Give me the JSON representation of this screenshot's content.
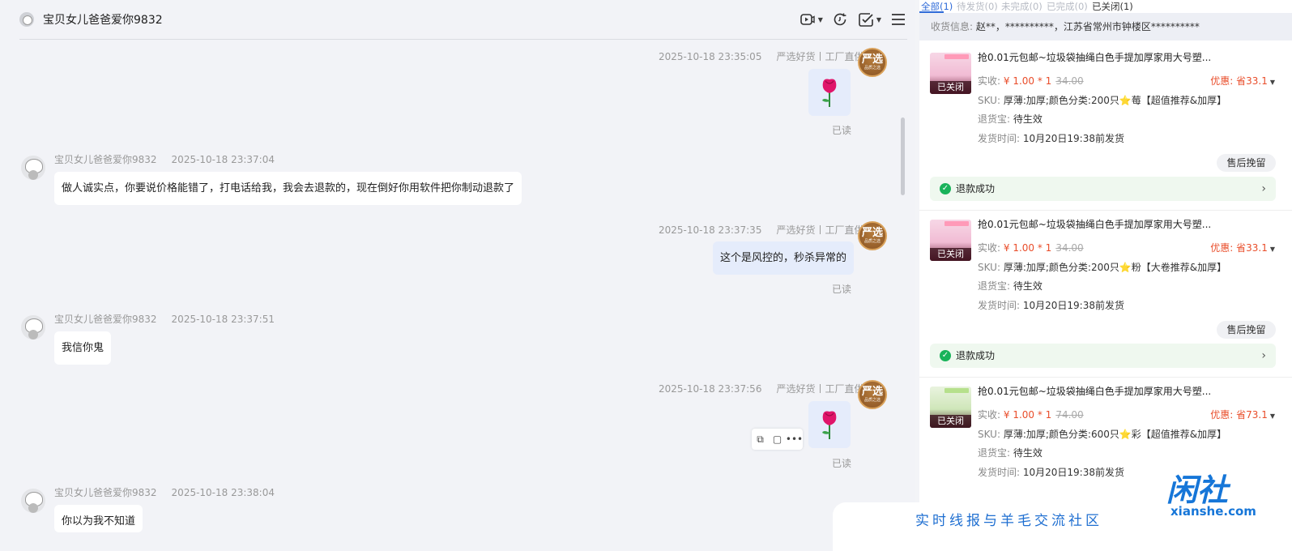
{
  "chat": {
    "title": "宝贝女儿爸爸爱你9832",
    "read_label": "已读",
    "messages": [
      {
        "time": "2025-10-18 23:35:05",
        "shop": "严选好货丨工厂直供"
      },
      {
        "name": "宝贝女儿爸爸爱你9832",
        "time": "2025-10-18 23:37:04",
        "text": "做人诚实点，你要说价格能错了，打电话给我，我会去退款的，现在倒好你用软件把你制动退款了"
      },
      {
        "time": "2025-10-18 23:37:35",
        "shop": "严选好货丨工厂直供",
        "text": "这个是风控的，秒杀异常的"
      },
      {
        "name": "宝贝女儿爸爸爱你9832",
        "time": "2025-10-18 23:37:51",
        "text": "我信你鬼"
      },
      {
        "time": "2025-10-18 23:37:56",
        "shop": "严选好货丨工厂直供"
      },
      {
        "name": "宝贝女儿爸爸爱你9832",
        "time": "2025-10-18 23:38:04",
        "text": "你以为我不知道"
      }
    ],
    "shop_avatar_text": "严选",
    "shop_avatar_sub": "品质之选"
  },
  "orders": {
    "tabs": [
      {
        "label": "全部(1)"
      },
      {
        "label": "待发货(0)"
      },
      {
        "label": "未完成(0)"
      },
      {
        "label": "已完成(0)"
      },
      {
        "label": "已关闭(1)"
      }
    ],
    "address_label": "收货信息:",
    "address_value": "赵**，**********，江苏省常州市钟楼区**********",
    "paid_label": "实收:",
    "sku_label": "SKU:",
    "tuihuobao_label": "退货宝:",
    "tuihuobao_value": "待生效",
    "ship_label": "发货时间:",
    "ship_value": "10月20日19:38前发货",
    "closed_tag": "已关闭",
    "aftersale_button": "售后挽留",
    "refund_status": "退款成功",
    "items": [
      {
        "title": "抢0.01元包邮~垃圾袋抽绳白色手提加厚家用大号塑...",
        "price": "¥ 1.00 * 1",
        "original": "34.00",
        "discount": "优惠: 省33.1",
        "sku": "厚薄:加厚;颜色分类:200只⭐莓【超值推荐&加厚】"
      },
      {
        "title": "抢0.01元包邮~垃圾袋抽绳白色手提加厚家用大号塑...",
        "price": "¥ 1.00 * 1",
        "original": "34.00",
        "discount": "优惠: 省33.1",
        "sku": "厚薄:加厚;颜色分类:200只⭐粉【大卷推荐&加厚】"
      },
      {
        "title": "抢0.01元包邮~垃圾袋抽绳白色手提加厚家用大号塑...",
        "price": "¥ 1.00 * 1",
        "original": "74.00",
        "discount": "优惠: 省73.1",
        "sku": "厚薄:加厚;颜色分类:600只⭐彩【超值推荐&加厚】"
      }
    ]
  },
  "watermark": {
    "slogan": "实时线报与羊毛交流社区",
    "logo": "闲社",
    "url": "xianshe.com"
  }
}
